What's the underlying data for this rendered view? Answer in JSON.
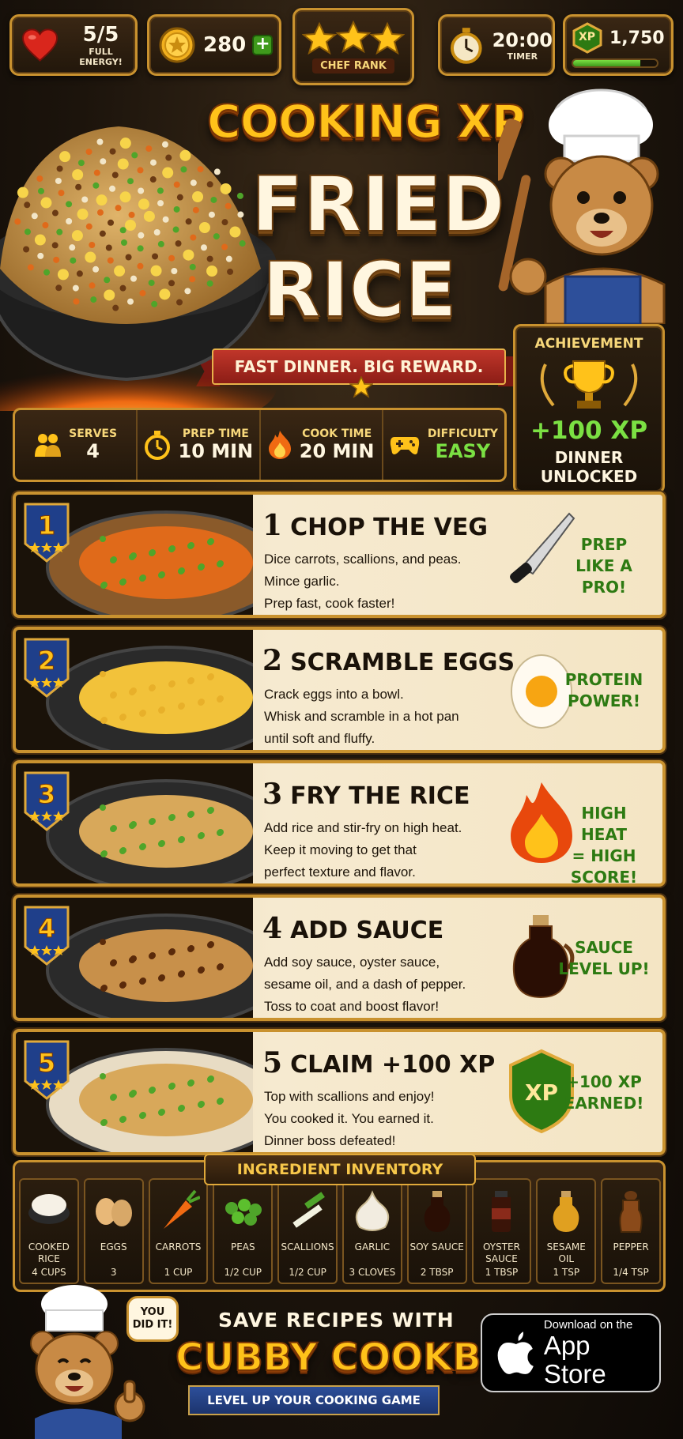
{
  "hud": {
    "energy": {
      "value": "5/5",
      "label": "FULL ENERGY!",
      "icon": "heart-icon"
    },
    "coins": {
      "value": "280",
      "icon": "coin-icon",
      "add_icon": "plus-icon"
    },
    "rank": {
      "label": "CHEF RANK",
      "stars": 3
    },
    "timer": {
      "value": "20:00",
      "label": "TIMER",
      "icon": "stopwatch-icon"
    },
    "xp": {
      "badge": "XP",
      "value": "1,750",
      "progress": 0.8
    }
  },
  "title": {
    "line1": "COOKING XP",
    "line2": "FRIED",
    "line3": "RICE",
    "ribbon": "FAST DINNER. BIG REWARD."
  },
  "info": {
    "serves_label": "SERVES",
    "serves_value": "4",
    "prep_label": "PREP TIME",
    "prep_value": "10 MIN",
    "cook_label": "COOK TIME",
    "cook_value": "20 MIN",
    "difficulty_label": "DIFFICULTY",
    "difficulty_value": "EASY"
  },
  "achievement": {
    "label": "ACHIEVEMENT",
    "xp": "+100 XP",
    "line1": "DINNER",
    "line2": "UNLOCKED"
  },
  "steps": [
    {
      "num": "1",
      "title": "CHOP THE VEG",
      "lines": [
        "Dice carrots, scallions, and peas.",
        "Mince garlic.",
        "Prep fast, cook faster!"
      ],
      "tag1": "PREP",
      "tag2": "LIKE A PRO!",
      "icon": "knife-icon"
    },
    {
      "num": "2",
      "title": "SCRAMBLE EGGS",
      "lines": [
        "Crack eggs into a bowl.",
        "Whisk and scramble in a hot pan",
        "until soft and fluffy."
      ],
      "tag1": "PROTEIN",
      "tag2": "POWER!",
      "icon": "egg-icon"
    },
    {
      "num": "3",
      "title": "FRY THE RICE",
      "lines": [
        "Add rice and stir-fry on high heat.",
        "Keep it moving to get that",
        "perfect texture and flavor."
      ],
      "tag1": "HIGH HEAT",
      "tag2": "= HIGH SCORE!",
      "icon": "fire-icon"
    },
    {
      "num": "4",
      "title": "ADD SAUCE",
      "lines": [
        "Add soy sauce, oyster sauce,",
        "sesame oil, and a dash of pepper.",
        "Toss to coat and boost flavor!"
      ],
      "tag1": "SAUCE",
      "tag2": "LEVEL UP!",
      "icon": "sauce-bottle-icon"
    },
    {
      "num": "5",
      "title": "CLAIM +100 XP",
      "lines": [
        "Top with scallions and enjoy!",
        "You cooked it. You earned it.",
        "Dinner boss defeated!"
      ],
      "tag1": "+100 XP",
      "tag2": "EARNED!",
      "icon": "xp-shield-icon"
    }
  ],
  "inventory": {
    "title": "INGREDIENT INVENTORY",
    "items": [
      {
        "name": "COOKED RICE",
        "qty": "4 CUPS",
        "icon": "rice-bowl-icon"
      },
      {
        "name": "EGGS",
        "qty": "3",
        "icon": "eggs-icon"
      },
      {
        "name": "CARROTS",
        "qty": "1 CUP",
        "icon": "carrot-icon"
      },
      {
        "name": "PEAS",
        "qty": "1/2 CUP",
        "icon": "peas-icon"
      },
      {
        "name": "SCALLIONS",
        "qty": "1/2 CUP",
        "icon": "scallion-icon"
      },
      {
        "name": "GARLIC",
        "qty": "3 CLOVES",
        "icon": "garlic-icon"
      },
      {
        "name": "SOY SAUCE",
        "qty": "2 TBSP",
        "icon": "soy-sauce-icon"
      },
      {
        "name": "OYSTER SAUCE",
        "qty": "1 TBSP",
        "icon": "oyster-sauce-icon"
      },
      {
        "name": "SESAME OIL",
        "qty": "1 TSP",
        "icon": "sesame-oil-icon"
      },
      {
        "name": "PEPPER",
        "qty": "1/4 TSP",
        "icon": "pepper-grinder-icon"
      }
    ]
  },
  "footer": {
    "bubble": "YOU DID IT!",
    "head": "SAVE RECIPES WITH",
    "brand": "CUBBY COOKBOOK",
    "sub": "LEVEL UP YOUR COOKING GAME",
    "store_small": "Download on the",
    "store_big": "App Store"
  },
  "colors": {
    "gold_border": "#c9922f",
    "title_gold": "#ffc21a",
    "tag_green": "#2d7a12",
    "parchment": "#f6ead0",
    "badge_blue": "#1f3f8a"
  }
}
